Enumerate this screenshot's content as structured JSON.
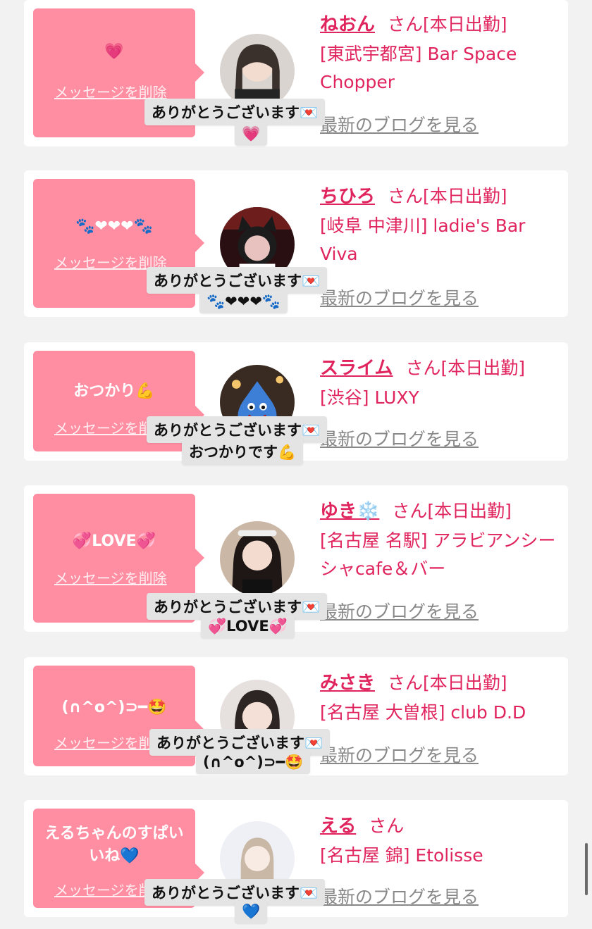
{
  "delete_label": "メッセージを削除",
  "blog_label": "最新のブログを見る",
  "thanks_label": "ありがとうございます💌",
  "cards": [
    {
      "bubble_message": "💗",
      "name": "ねおん",
      "suffix": "さん[本日出勤]",
      "shop": "[東武宇都宮] Bar Space Chopper",
      "reply_emoji": "💗"
    },
    {
      "bubble_message": "🐾❤❤❤🐾",
      "name": "ちひろ",
      "suffix": "さん[本日出勤]",
      "shop": "[岐阜 中津川] ladie's Bar Viva",
      "reply_emoji": "🐾❤❤❤🐾"
    },
    {
      "bubble_message": "おつかり💪",
      "name": "スライム",
      "suffix": "さん[本日出勤]",
      "shop": "[渋谷] LUXY",
      "reply_emoji": "おつかりです💪"
    },
    {
      "bubble_message": "💞LOVE💞",
      "name": "ゆき❄️",
      "suffix": "さん[本日出勤]",
      "shop": "[名古屋 名駅] アラビアンシーシャcafe＆バー",
      "reply_emoji": "💞LOVE💞"
    },
    {
      "bubble_message": "(∩^o^)⊃━🤩",
      "name": "みさき",
      "suffix": "さん[本日出勤]",
      "shop": "[名古屋 大曽根] club D.D",
      "reply_emoji": "(∩^o^)⊃━🤩"
    },
    {
      "bubble_message": "えるちゃんのすぱいいね💙",
      "name": "える",
      "suffix": "さん",
      "shop": "[名古屋 錦] Etolisse",
      "reply_emoji": "💙"
    }
  ],
  "colors": {
    "page_background": "#f2f2f2",
    "card_background": "#ffffff",
    "bubble_pink": "#ff8ea2",
    "accent_pink": "#e0245e",
    "link_gray": "#888888",
    "toast_background": "#e4e4e4"
  }
}
